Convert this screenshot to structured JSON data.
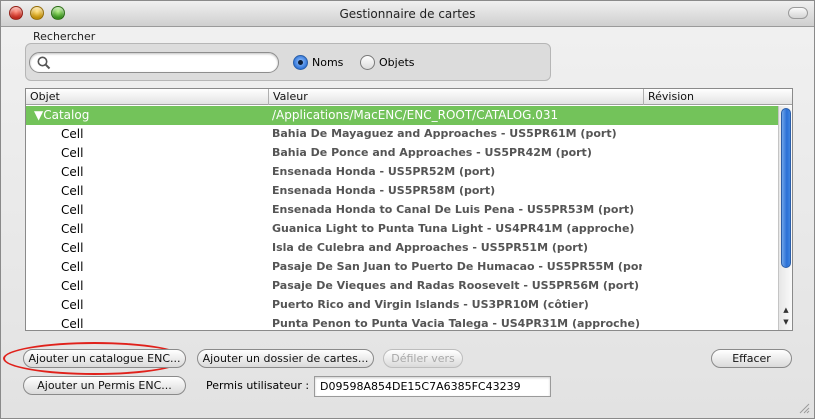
{
  "window": {
    "title": "Gestionnaire de cartes"
  },
  "search": {
    "caption": "Rechercher",
    "value": "",
    "placeholder": "",
    "options": [
      {
        "label": "Noms",
        "selected": true
      },
      {
        "label": "Objets",
        "selected": false
      }
    ]
  },
  "table": {
    "columns": [
      "Objet",
      "Valeur",
      "Révision"
    ],
    "rows": [
      {
        "object": "▼Catalog",
        "value": "/Applications/MacENC/ENC_ROOT/CATALOG.031",
        "revision": "",
        "selected": true
      },
      {
        "object": "Cell",
        "value": "Bahia De Mayaguez and Approaches - US5PR61M (port)",
        "revision": ""
      },
      {
        "object": "Cell",
        "value": "Bahia De Ponce and Approaches - US5PR42M (port)",
        "revision": ""
      },
      {
        "object": "Cell",
        "value": "Ensenada Honda - US5PR52M (port)",
        "revision": ""
      },
      {
        "object": "Cell",
        "value": "Ensenada Honda - US5PR58M (port)",
        "revision": ""
      },
      {
        "object": "Cell",
        "value": "Ensenada Honda to Canal De Luis Pena - US5PR53M (port)",
        "revision": ""
      },
      {
        "object": "Cell",
        "value": "Guanica Light to Punta Tuna Light - US4PR41M (approche)",
        "revision": ""
      },
      {
        "object": "Cell",
        "value": "Isla de Culebra and Approaches - US5PR51M (port)",
        "revision": ""
      },
      {
        "object": "Cell",
        "value": "Pasaje De San Juan to Puerto De Humacao - US5PR55M (por",
        "revision": ""
      },
      {
        "object": "Cell",
        "value": "Pasaje De Vieques and Radas Roosevelt - US5PR56M (port)",
        "revision": ""
      },
      {
        "object": "Cell",
        "value": "Puerto Rico and Virgin Islands - US3PR10M (côtier)",
        "revision": ""
      },
      {
        "object": "Cell",
        "value": "Punta Penon to Punta Vacia Talega - US4PR31M (approche)",
        "revision": ""
      }
    ]
  },
  "buttons": {
    "add_catalog": "Ajouter un catalogue ENC...",
    "add_folder": "Ajouter un dossier de cartes...",
    "scroll_to": "Défiler vers",
    "clear": "Effacer",
    "add_permit": "Ajouter un Permis ENC..."
  },
  "permit": {
    "label": "Permis utilisateur :",
    "value": "D09598A854DE15C7A6385FC43239"
  },
  "colors": {
    "selection": "#73c35a",
    "highlight_circle": "#e0211b",
    "radio_selected": "#2a6fd6"
  }
}
